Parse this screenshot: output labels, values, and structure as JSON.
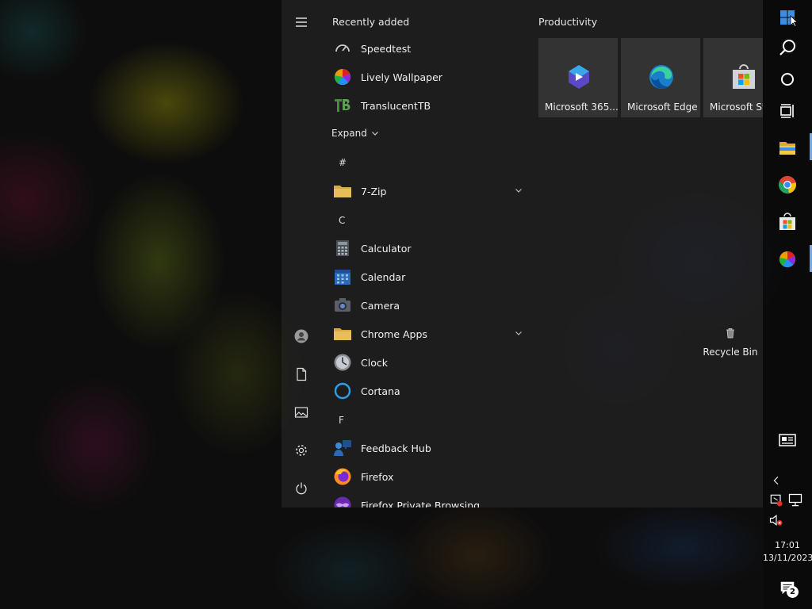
{
  "start_menu": {
    "recently_added_title": "Recently added",
    "recent_apps": [
      {
        "label": "Speedtest",
        "icon": "speedtest-icon"
      },
      {
        "label": "Lively Wallpaper",
        "icon": "lively-wallpaper-icon"
      },
      {
        "label": "TranslucentTB",
        "icon": "translucenttb-icon"
      }
    ],
    "expand_label": "Expand",
    "letters": [
      "#",
      "C",
      "F"
    ],
    "apps": [
      {
        "label": "7-Zip",
        "icon": "folder-icon",
        "expandable": true
      },
      {
        "label": "Calculator",
        "icon": "calculator-icon"
      },
      {
        "label": "Calendar",
        "icon": "calendar-icon"
      },
      {
        "label": "Camera",
        "icon": "camera-icon"
      },
      {
        "label": "Chrome Apps",
        "icon": "folder-icon",
        "expandable": true
      },
      {
        "label": "Clock",
        "icon": "clock-icon"
      },
      {
        "label": "Cortana",
        "icon": "cortana-icon"
      },
      {
        "label": "Feedback Hub",
        "icon": "feedback-hub-icon"
      },
      {
        "label": "Firefox",
        "icon": "firefox-icon"
      },
      {
        "label": "Firefox Private Browsing",
        "icon": "firefox-private-icon"
      }
    ],
    "tiles_group_title": "Productivity",
    "tiles": [
      {
        "label": "Microsoft 365...",
        "icon": "microsoft-365-icon"
      },
      {
        "label": "Microsoft Edge",
        "icon": "edge-icon"
      },
      {
        "label": "Microsoft Store",
        "icon": "store-icon"
      }
    ],
    "rail": [
      "hamburger-icon",
      "user-icon",
      "document-icon",
      "pictures-icon",
      "settings-icon",
      "power-icon"
    ]
  },
  "desktop": {
    "recycle_bin_label": "Recycle Bin"
  },
  "taskbar": {
    "time": "17:01",
    "date": "13/11/2023",
    "notification_count": "2",
    "pinned": [
      "windows-start-icon",
      "search-icon",
      "cortana-ring-icon",
      "task-view-icon",
      "file-explorer-icon",
      "chrome-icon",
      "store-icon",
      "lively-wallpaper-icon"
    ]
  },
  "colors": {
    "accent": "#0078d4",
    "active_indicator": "#7aa8d8",
    "menu_bg": "#222222"
  }
}
